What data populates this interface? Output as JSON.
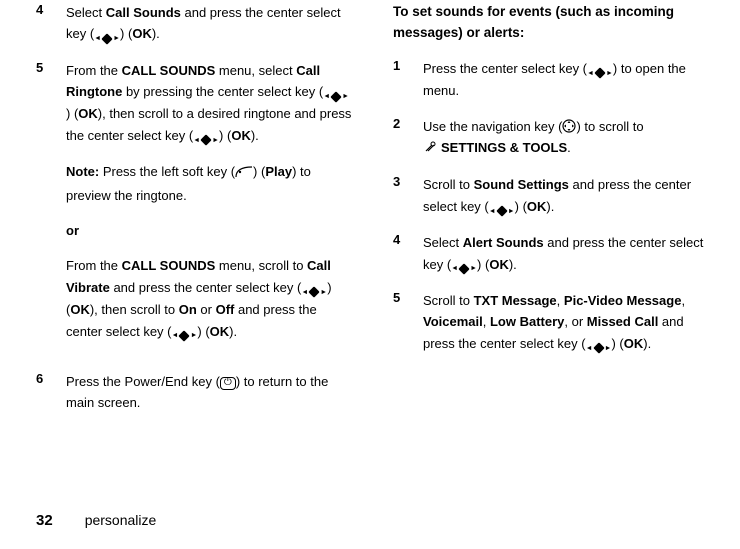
{
  "left": {
    "step4": {
      "num": "4",
      "text_before": "Select ",
      "call_sounds": "Call Sounds",
      "text_mid": " and press the center select key (",
      "ok": "OK",
      "text_after": ")."
    },
    "step5": {
      "num": "5",
      "p1_a": "From the ",
      "p1_menu": "CALL SOUNDS",
      "p1_b": " menu, select ",
      "p1_ringtone": "Call Ringtone",
      "p1_c": " by pressing the center select key (",
      "p1_ok1": "OK",
      "p1_d": "), then scroll to a desired ringtone and press the center select key (",
      "p1_ok2": "OK",
      "p1_e": ").",
      "note_label": "Note:",
      "note_a": " Press the left soft key (",
      "note_play": "Play",
      "note_b": ") to preview the ringtone.",
      "or": "or",
      "p2_a": "From the ",
      "p2_menu": "CALL SOUNDS",
      "p2_b": " menu, scroll to ",
      "p2_vibrate": "Call Vibrate",
      "p2_c": " and press the center select key (",
      "p2_ok1": "OK",
      "p2_d": "), then scroll to ",
      "p2_on": "On",
      "p2_or": " or ",
      "p2_off": "Off",
      "p2_e": " and press the center select key (",
      "p2_ok2": "OK",
      "p2_f": ")."
    },
    "step6": {
      "num": "6",
      "a": "Press the Power/End key (",
      "end_glyph": "⏻",
      "b": ") to return to the main screen."
    }
  },
  "right": {
    "subhead": "To set sounds for events (such as incoming messages) or alerts:",
    "step1": {
      "num": "1",
      "a": "Press the center select key (",
      "b": ") to open the menu."
    },
    "step2": {
      "num": "2",
      "a": "Use the navigation key (",
      "b": ") to scroll to ",
      "menu": "SETTINGS & TOOLS",
      "c": "."
    },
    "step3": {
      "num": "3",
      "a": "Scroll to ",
      "menu": "Sound Settings",
      "b": " and press the center select key (",
      "ok": "OK",
      "c": ")."
    },
    "step4": {
      "num": "4",
      "a": "Select ",
      "menu": "Alert Sounds",
      "b": " and press the center select key (",
      "ok": "OK",
      "c": ")."
    },
    "step5": {
      "num": "5",
      "a": "Scroll to ",
      "m1": "TXT Message",
      "s1": ", ",
      "m2": "Pic-Video Message",
      "s2": ", ",
      "m3": "Voicemail",
      "s3": ", ",
      "m4": "Low Battery",
      "s4": ", or ",
      "m5": "Missed Call",
      "b": " and press the center select key (",
      "ok": "OK",
      "c": ")."
    }
  },
  "footer": {
    "page": "32",
    "section": "personalize"
  }
}
